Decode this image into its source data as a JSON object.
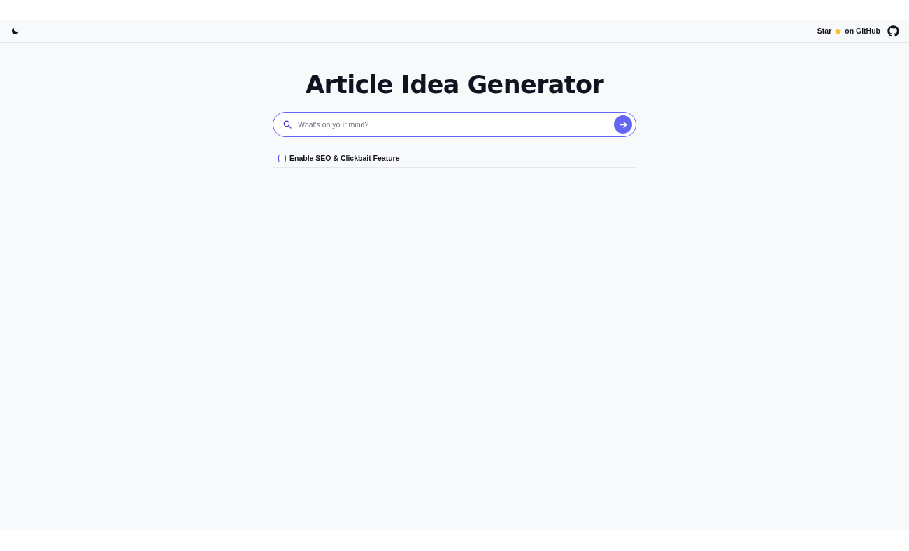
{
  "header": {
    "theme_toggle": {
      "dark": false
    },
    "github_link": {
      "label_before": "Star",
      "label_after": "on GitHub"
    }
  },
  "title": "Article Idea Generator",
  "search": {
    "placeholder": "What's on your mind?"
  },
  "options": [
    {
      "label": "Enable SEO & Clickbait Feature",
      "checked": false
    }
  ]
}
